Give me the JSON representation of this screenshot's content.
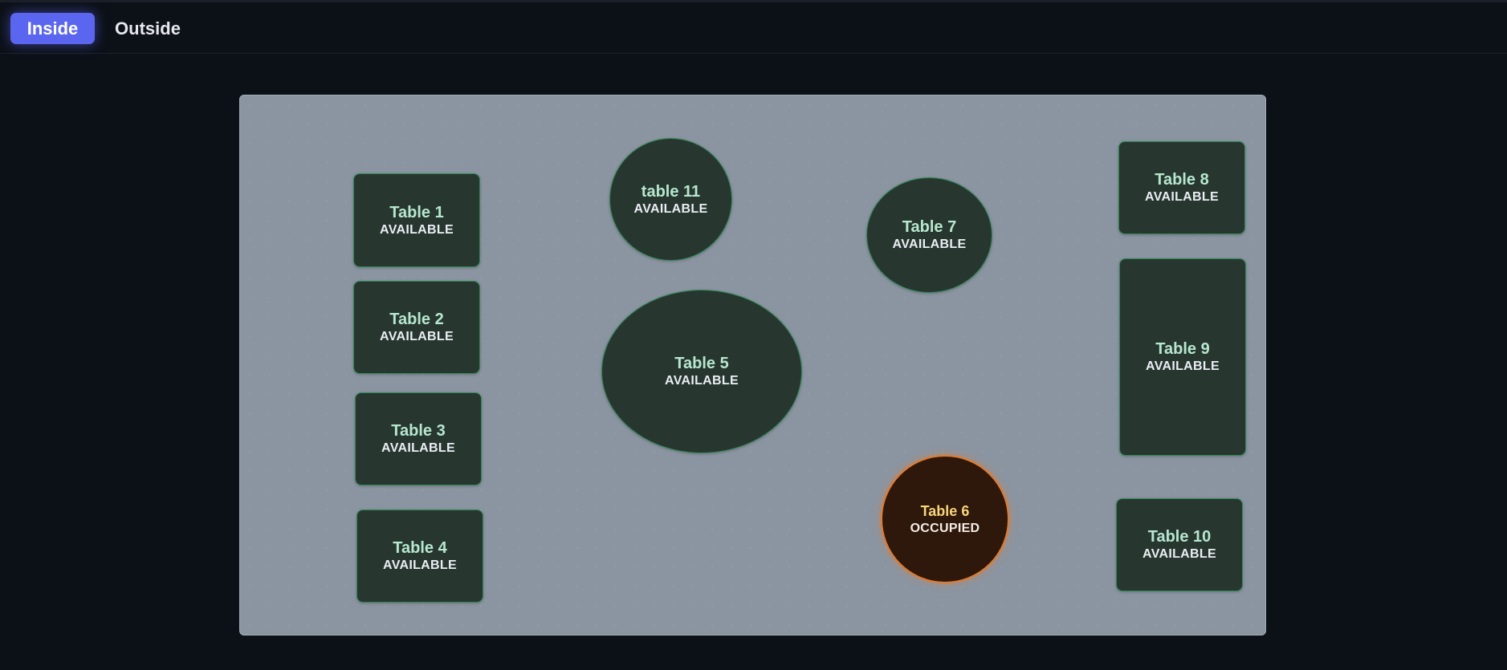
{
  "tabs": [
    {
      "label": "Inside",
      "active": true
    },
    {
      "label": "Outside",
      "active": false
    }
  ],
  "colors": {
    "background": "#0c1017",
    "accent": "#5b66f0",
    "floor": "#8b95a1",
    "table_fill": "#283630",
    "available_border": "#2f8a56",
    "occupied_fill": "#2e170b",
    "occupied_border": "#e07a2e"
  },
  "tables": {
    "t1": {
      "name": "Table 1",
      "status": "AVAILABLE"
    },
    "t2": {
      "name": "Table 2",
      "status": "AVAILABLE"
    },
    "t3": {
      "name": "Table 3",
      "status": "AVAILABLE"
    },
    "t4": {
      "name": "Table 4",
      "status": "AVAILABLE"
    },
    "t5": {
      "name": "Table 5",
      "status": "AVAILABLE"
    },
    "t6": {
      "name": "Table 6",
      "status": "OCCUPIED"
    },
    "t7": {
      "name": "Table 7",
      "status": "AVAILABLE"
    },
    "t8": {
      "name": "Table 8",
      "status": "AVAILABLE"
    },
    "t9": {
      "name": "Table 9",
      "status": "AVAILABLE"
    },
    "t10": {
      "name": "Table 10",
      "status": "AVAILABLE"
    },
    "t11": {
      "name": "table 11",
      "status": "AVAILABLE"
    }
  }
}
